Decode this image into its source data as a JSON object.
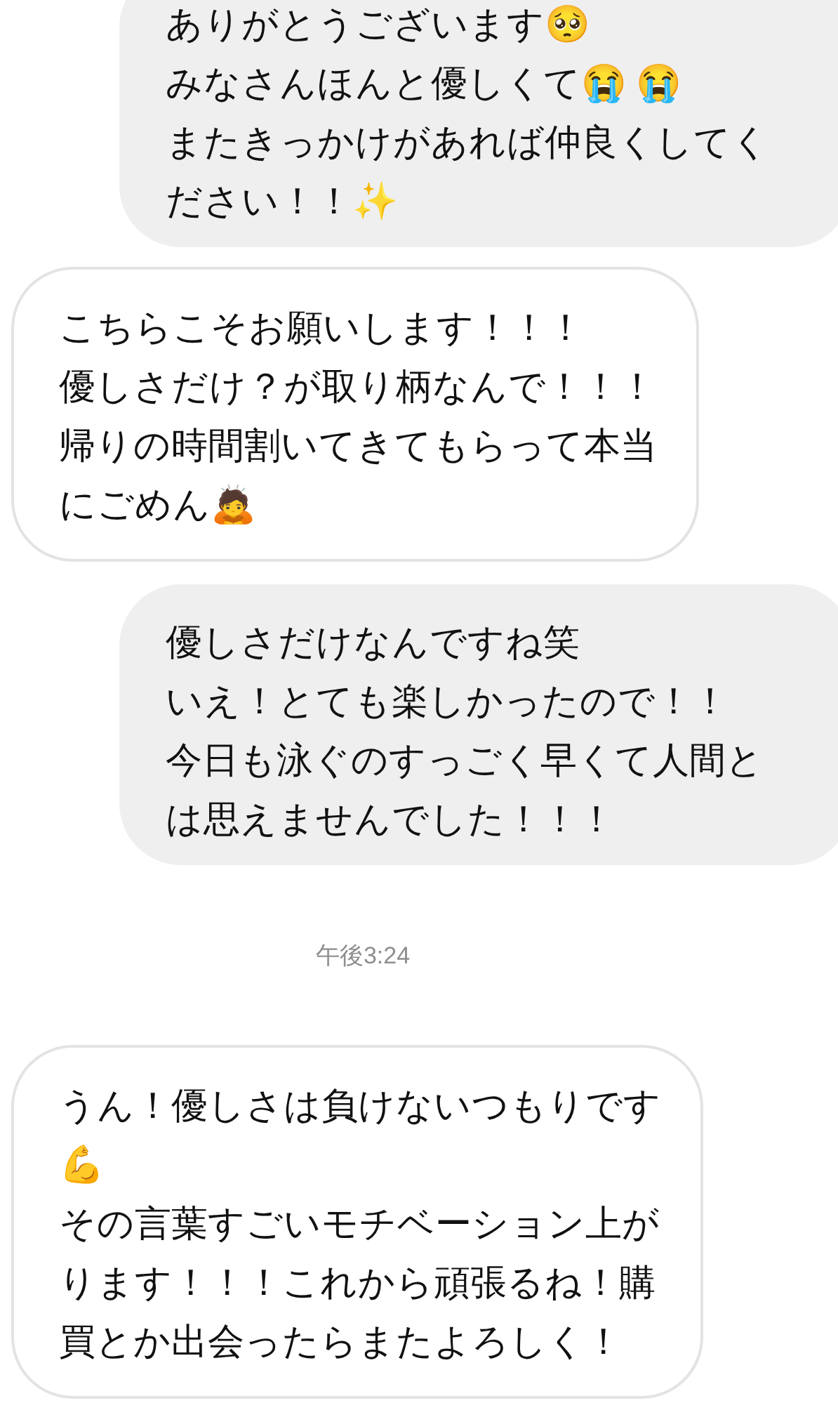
{
  "messages": [
    {
      "kind": "sent",
      "lines": [
        "ありがとうございます🥺",
        "みなさんほんと優しくて😭 😭",
        "またきっかけがあれば仲良くしてく",
        "ださい！！✨"
      ]
    },
    {
      "kind": "received",
      "lines": [
        "こちらこそお願いします！！！",
        "優しさだけ？が取り柄なんで！！！",
        "帰りの時間割いてきてもらって本当",
        "にごめん🙇"
      ]
    },
    {
      "kind": "sent",
      "lines": [
        "優しさだけなんですね笑",
        "いえ！とても楽しかったので！！",
        "今日も泳ぐのすっごく早くて人間と",
        "は思えませんでした！！！"
      ]
    },
    {
      "kind": "timestamp",
      "lines": [
        "午後3:24"
      ]
    },
    {
      "kind": "received",
      "lines": [
        "うん！優しさは負けないつもりです",
        "💪",
        "その言葉すごいモチベーション上が",
        "ります！！！これから頑張るね！購",
        "買とか出会ったらまたよろしく！"
      ]
    }
  ]
}
